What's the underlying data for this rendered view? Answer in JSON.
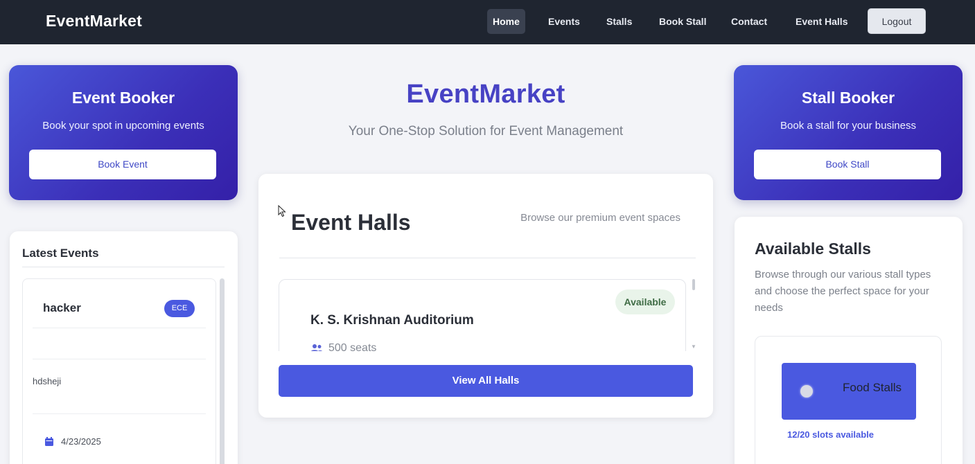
{
  "navbar": {
    "brand": "EventMarket",
    "links": [
      {
        "label": "Home",
        "active": true
      },
      {
        "label": "Events"
      },
      {
        "label": "Stalls"
      },
      {
        "label": "Book Stall"
      },
      {
        "label": "Contact"
      },
      {
        "label": "Event Halls"
      }
    ],
    "logout_label": "Logout"
  },
  "event_booker": {
    "title": "Event Booker",
    "subtitle": "Book your spot in upcoming events",
    "button_label": "Book Event"
  },
  "stall_booker": {
    "title": "Stall Booker",
    "subtitle": "Book a stall for your business",
    "button_label": "Book Stall"
  },
  "hero": {
    "title": "EventMarket",
    "subtitle": "Your One-Stop Solution for Event Management"
  },
  "event_halls": {
    "title": "Event Halls",
    "browse_text": "Browse our premium event spaces",
    "halls": [
      {
        "name": "K. S. Krishnan Auditorium",
        "status": "Available",
        "seats": "500 seats"
      }
    ],
    "view_all_label": "View All Halls"
  },
  "latest_events": {
    "title": "Latest Events",
    "events": [
      {
        "name": "hacker",
        "tag": "ECE",
        "description": "hdsheji",
        "date": "4/23/2025"
      }
    ]
  },
  "available_stalls": {
    "title": "Available Stalls",
    "description": "Browse through our various stall types and choose the perfect space for your needs",
    "stalls": [
      {
        "name": "Food Stalls",
        "slots": "12/20 slots available"
      }
    ]
  },
  "colors": {
    "navbar_bg": "#1f2530",
    "accent": "#4a59e0",
    "hero_title": "#4742c4",
    "available_badge_bg": "#e9f4ea"
  }
}
